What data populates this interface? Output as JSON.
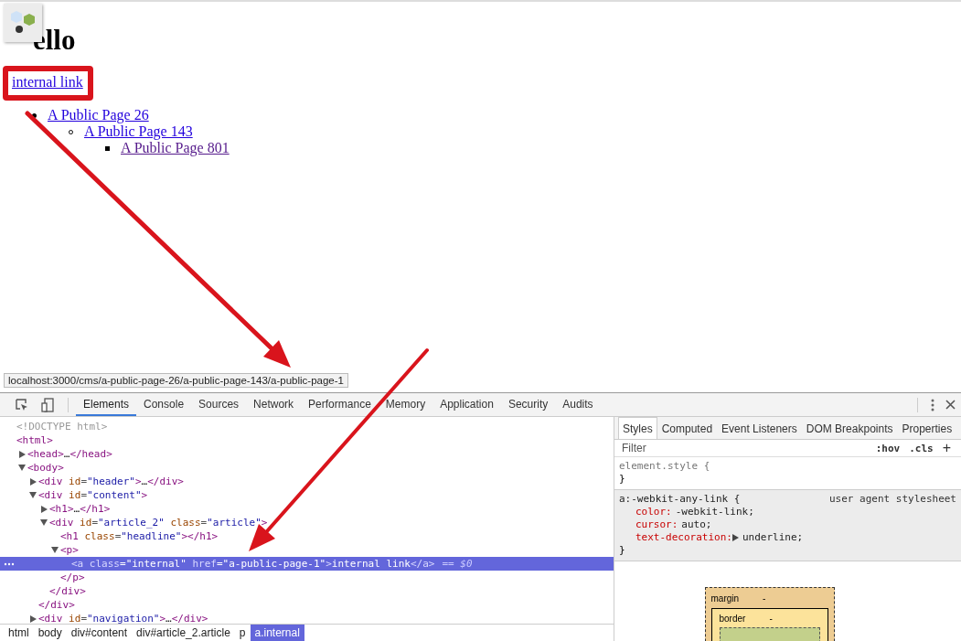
{
  "page": {
    "heading": "ello",
    "link": "internal link",
    "list": [
      {
        "text": "A Public Page 26",
        "visited": false,
        "children": [
          {
            "text": "A Public Page 143",
            "visited": false,
            "children": [
              {
                "text": "A Public Page 801",
                "visited": true
              }
            ]
          }
        ]
      }
    ]
  },
  "status_url": "localhost:3000/cms/a-public-page-26/a-public-page-143/a-public-page-1",
  "devtools": {
    "tabs": [
      {
        "label": "Elements",
        "selected": true
      },
      {
        "label": "Console",
        "selected": false
      },
      {
        "label": "Sources",
        "selected": false
      },
      {
        "label": "Network",
        "selected": false
      },
      {
        "label": "Performance",
        "selected": false
      },
      {
        "label": "Memory",
        "selected": false
      },
      {
        "label": "Application",
        "selected": false
      },
      {
        "label": "Security",
        "selected": false
      },
      {
        "label": "Audits",
        "selected": false
      }
    ],
    "elements_tree": [
      {
        "text": "<!DOCTYPE html>",
        "kind": "doctype",
        "selected": false
      },
      {
        "text": "<html>",
        "selected": false,
        "children": [
          {
            "text": "<head>…</head>",
            "kind": "collapsed",
            "selected": false
          },
          {
            "text": "<body>",
            "kind": "expanded",
            "selected": false,
            "children": [
              {
                "text": "<div id=\"header\">…</div>",
                "kind": "collapsed",
                "selected": false
              },
              {
                "text": "<div id=\"content\">",
                "kind": "expanded",
                "selected": false,
                "closing": "</div>",
                "children": [
                  {
                    "text": "<h1>…</h1>",
                    "kind": "collapsed",
                    "selected": false
                  },
                  {
                    "text": "<div id=\"article_2\" class=\"article\">",
                    "kind": "expanded",
                    "selected": false,
                    "closing": "</div>",
                    "children": [
                      {
                        "text": "<h1 class=\"headline\"></h1>",
                        "selected": false
                      },
                      {
                        "text": "<p>",
                        "kind": "expanded",
                        "selected": false,
                        "closing": "</p>",
                        "children": [
                          {
                            "text": "<a class=\"internal\" href=\"a-public-page-1\">internal link</a>",
                            "suffix": "== $0",
                            "selected": true
                          }
                        ]
                      }
                    ]
                  }
                ]
              },
              {
                "text": "<div id=\"navigation\">…</div>",
                "kind": "collapsed",
                "selected": false
              }
            ]
          }
        ]
      }
    ],
    "breadcrumbs": [
      {
        "label": "html",
        "selected": false
      },
      {
        "label": "body",
        "selected": false
      },
      {
        "label": "div#content",
        "selected": false
      },
      {
        "label": "div#article_2.article",
        "selected": false
      },
      {
        "label": "p",
        "selected": false
      },
      {
        "label": "a.internal",
        "selected": true
      }
    ],
    "styles_tabs": [
      {
        "label": "Styles",
        "selected": true
      },
      {
        "label": "Computed",
        "selected": false
      },
      {
        "label": "Event Listeners",
        "selected": false
      },
      {
        "label": "DOM Breakpoints",
        "selected": false
      },
      {
        "label": "Properties",
        "selected": false
      }
    ],
    "filter": {
      "placeholder": "Filter"
    },
    "filter_buttons": [
      ":hov",
      ".cls",
      "+"
    ],
    "rules": [
      {
        "kind": "inline",
        "selector": "element.style {",
        "closing": "}"
      },
      {
        "kind": "user_agent",
        "selector": "a:-webkit-any-link {",
        "source": "user agent stylesheet",
        "closing": "}",
        "declarations": [
          {
            "property": "color:",
            "value": "-webkit-link;",
            "expandable": false
          },
          {
            "property": "cursor:",
            "value": "auto;",
            "expandable": false
          },
          {
            "property": "text-decoration:",
            "value": "underline;",
            "expandable": true
          }
        ]
      }
    ],
    "box_model": {
      "margin": {
        "label": "margin",
        "value": "-"
      },
      "border": {
        "label": "border",
        "value": "-"
      }
    }
  }
}
